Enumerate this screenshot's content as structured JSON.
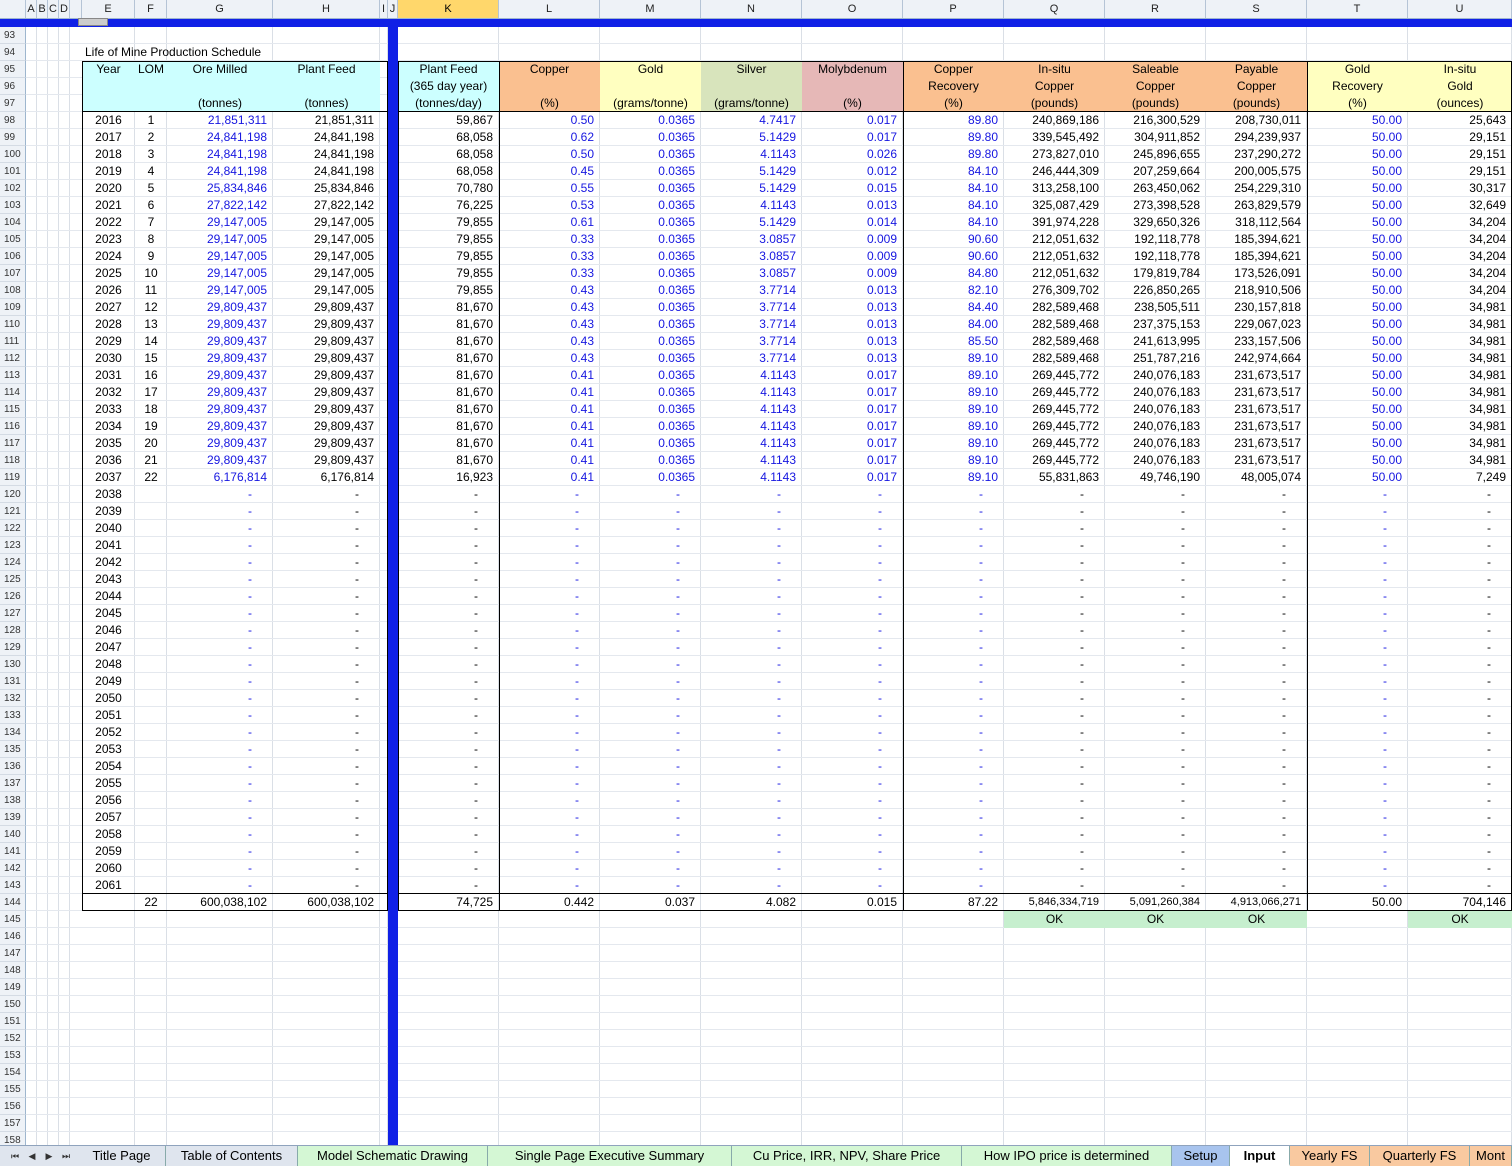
{
  "colors": {
    "blue_value": "#1616e0",
    "freeze_bar": "#1020e6",
    "header_cyan": "#ccffff",
    "header_orange": "#fac090",
    "header_yellow": "#ffffc0",
    "header_green": "#d8e4bc",
    "header_pink": "#e6b8b7",
    "ok_green": "#c6efce"
  },
  "column_letters": [
    "A",
    "B",
    "C",
    "D",
    "E",
    "F",
    "G",
    "H",
    "I",
    "J",
    "K",
    "L",
    "M",
    "N",
    "O",
    "P",
    "Q",
    "R",
    "S",
    "T",
    "U"
  ],
  "selected_column": "K",
  "sheet": {
    "title": "Life of Mine Production Schedule",
    "headers": {
      "E": [
        "Year",
        "",
        ""
      ],
      "F": [
        "LOM",
        "",
        ""
      ],
      "G": [
        "Ore Milled",
        "",
        "(tonnes)"
      ],
      "H": [
        "Plant Feed",
        "",
        "(tonnes)"
      ],
      "K": [
        "Plant Feed",
        "(365 day year)",
        "(tonnes/day)"
      ],
      "L": [
        "Copper",
        "",
        "(%)"
      ],
      "M": [
        "Gold",
        "",
        "(grams/tonne)"
      ],
      "N": [
        "Silver",
        "",
        "(grams/tonne)"
      ],
      "O": [
        "Molybdenum",
        "",
        "(%)"
      ],
      "P": [
        "Copper",
        "Recovery",
        "(%)"
      ],
      "Q": [
        "In-situ",
        "Copper",
        "(pounds)"
      ],
      "R": [
        "Saleable",
        "Copper",
        "(pounds)"
      ],
      "S": [
        "Payable",
        "Copper",
        "(pounds)"
      ],
      "T": [
        "Gold",
        "Recovery",
        "(%)"
      ],
      "U": [
        "In-situ",
        "Gold",
        "(ounces)"
      ]
    },
    "rows": [
      [
        "2016",
        "1",
        "21,851,311",
        "21,851,311",
        "59,867",
        "0.50",
        "0.0365",
        "4.7417",
        "0.017",
        "89.80",
        "240,869,186",
        "216,300,529",
        "208,730,011",
        "50.00",
        "25,643"
      ],
      [
        "2017",
        "2",
        "24,841,198",
        "24,841,198",
        "68,058",
        "0.62",
        "0.0365",
        "5.1429",
        "0.017",
        "89.80",
        "339,545,492",
        "304,911,852",
        "294,239,937",
        "50.00",
        "29,151"
      ],
      [
        "2018",
        "3",
        "24,841,198",
        "24,841,198",
        "68,058",
        "0.50",
        "0.0365",
        "4.1143",
        "0.026",
        "89.80",
        "273,827,010",
        "245,896,655",
        "237,290,272",
        "50.00",
        "29,151"
      ],
      [
        "2019",
        "4",
        "24,841,198",
        "24,841,198",
        "68,058",
        "0.45",
        "0.0365",
        "5.1429",
        "0.012",
        "84.10",
        "246,444,309",
        "207,259,664",
        "200,005,575",
        "50.00",
        "29,151"
      ],
      [
        "2020",
        "5",
        "25,834,846",
        "25,834,846",
        "70,780",
        "0.55",
        "0.0365",
        "5.1429",
        "0.015",
        "84.10",
        "313,258,100",
        "263,450,062",
        "254,229,310",
        "50.00",
        "30,317"
      ],
      [
        "2021",
        "6",
        "27,822,142",
        "27,822,142",
        "76,225",
        "0.53",
        "0.0365",
        "4.1143",
        "0.013",
        "84.10",
        "325,087,429",
        "273,398,528",
        "263,829,579",
        "50.00",
        "32,649"
      ],
      [
        "2022",
        "7",
        "29,147,005",
        "29,147,005",
        "79,855",
        "0.61",
        "0.0365",
        "5.1429",
        "0.014",
        "84.10",
        "391,974,228",
        "329,650,326",
        "318,112,564",
        "50.00",
        "34,204"
      ],
      [
        "2023",
        "8",
        "29,147,005",
        "29,147,005",
        "79,855",
        "0.33",
        "0.0365",
        "3.0857",
        "0.009",
        "90.60",
        "212,051,632",
        "192,118,778",
        "185,394,621",
        "50.00",
        "34,204"
      ],
      [
        "2024",
        "9",
        "29,147,005",
        "29,147,005",
        "79,855",
        "0.33",
        "0.0365",
        "3.0857",
        "0.009",
        "90.60",
        "212,051,632",
        "192,118,778",
        "185,394,621",
        "50.00",
        "34,204"
      ],
      [
        "2025",
        "10",
        "29,147,005",
        "29,147,005",
        "79,855",
        "0.33",
        "0.0365",
        "3.0857",
        "0.009",
        "84.80",
        "212,051,632",
        "179,819,784",
        "173,526,091",
        "50.00",
        "34,204"
      ],
      [
        "2026",
        "11",
        "29,147,005",
        "29,147,005",
        "79,855",
        "0.43",
        "0.0365",
        "3.7714",
        "0.013",
        "82.10",
        "276,309,702",
        "226,850,265",
        "218,910,506",
        "50.00",
        "34,204"
      ],
      [
        "2027",
        "12",
        "29,809,437",
        "29,809,437",
        "81,670",
        "0.43",
        "0.0365",
        "3.7714",
        "0.013",
        "84.40",
        "282,589,468",
        "238,505,511",
        "230,157,818",
        "50.00",
        "34,981"
      ],
      [
        "2028",
        "13",
        "29,809,437",
        "29,809,437",
        "81,670",
        "0.43",
        "0.0365",
        "3.7714",
        "0.013",
        "84.00",
        "282,589,468",
        "237,375,153",
        "229,067,023",
        "50.00",
        "34,981"
      ],
      [
        "2029",
        "14",
        "29,809,437",
        "29,809,437",
        "81,670",
        "0.43",
        "0.0365",
        "3.7714",
        "0.013",
        "85.50",
        "282,589,468",
        "241,613,995",
        "233,157,506",
        "50.00",
        "34,981"
      ],
      [
        "2030",
        "15",
        "29,809,437",
        "29,809,437",
        "81,670",
        "0.43",
        "0.0365",
        "3.7714",
        "0.013",
        "89.10",
        "282,589,468",
        "251,787,216",
        "242,974,664",
        "50.00",
        "34,981"
      ],
      [
        "2031",
        "16",
        "29,809,437",
        "29,809,437",
        "81,670",
        "0.41",
        "0.0365",
        "4.1143",
        "0.017",
        "89.10",
        "269,445,772",
        "240,076,183",
        "231,673,517",
        "50.00",
        "34,981"
      ],
      [
        "2032",
        "17",
        "29,809,437",
        "29,809,437",
        "81,670",
        "0.41",
        "0.0365",
        "4.1143",
        "0.017",
        "89.10",
        "269,445,772",
        "240,076,183",
        "231,673,517",
        "50.00",
        "34,981"
      ],
      [
        "2033",
        "18",
        "29,809,437",
        "29,809,437",
        "81,670",
        "0.41",
        "0.0365",
        "4.1143",
        "0.017",
        "89.10",
        "269,445,772",
        "240,076,183",
        "231,673,517",
        "50.00",
        "34,981"
      ],
      [
        "2034",
        "19",
        "29,809,437",
        "29,809,437",
        "81,670",
        "0.41",
        "0.0365",
        "4.1143",
        "0.017",
        "89.10",
        "269,445,772",
        "240,076,183",
        "231,673,517",
        "50.00",
        "34,981"
      ],
      [
        "2035",
        "20",
        "29,809,437",
        "29,809,437",
        "81,670",
        "0.41",
        "0.0365",
        "4.1143",
        "0.017",
        "89.10",
        "269,445,772",
        "240,076,183",
        "231,673,517",
        "50.00",
        "34,981"
      ],
      [
        "2036",
        "21",
        "29,809,437",
        "29,809,437",
        "81,670",
        "0.41",
        "0.0365",
        "4.1143",
        "0.017",
        "89.10",
        "269,445,772",
        "240,076,183",
        "231,673,517",
        "50.00",
        "34,981"
      ],
      [
        "2037",
        "22",
        "6,176,814",
        "6,176,814",
        "16,923",
        "0.41",
        "0.0365",
        "4.1143",
        "0.017",
        "89.10",
        "55,831,863",
        "49,746,190",
        "48,005,074",
        "50.00",
        "7,249"
      ]
    ],
    "empty_years": [
      "2038",
      "2039",
      "2040",
      "2041",
      "2042",
      "2043",
      "2044",
      "2045",
      "2046",
      "2047",
      "2048",
      "2049",
      "2050",
      "2051",
      "2052",
      "2053",
      "2054",
      "2055",
      "2056",
      "2057",
      "2058",
      "2059",
      "2060",
      "2061"
    ],
    "dash": "-",
    "totals": [
      "",
      "22",
      "600,038,102",
      "600,038,102",
      "74,725",
      "0.442",
      "0.037",
      "4.082",
      "0.015",
      "87.22",
      "5,846,334,719",
      "5,091,260,384",
      "4,913,066,271",
      "50.00",
      "704,146"
    ],
    "ok_label": "OK"
  },
  "row_numbers_start": 93,
  "row_numbers_end": 158,
  "tabs": [
    "Title Page",
    "Table of Contents",
    "Model Schematic Drawing",
    "Single Page  Executive Summary",
    "Cu Price, IRR, NPV, Share Price",
    "How IPO price is determined",
    "Setup",
    "Input",
    "Yearly FS",
    "Quarterly FS",
    "Mont"
  ],
  "active_tab": "Input"
}
